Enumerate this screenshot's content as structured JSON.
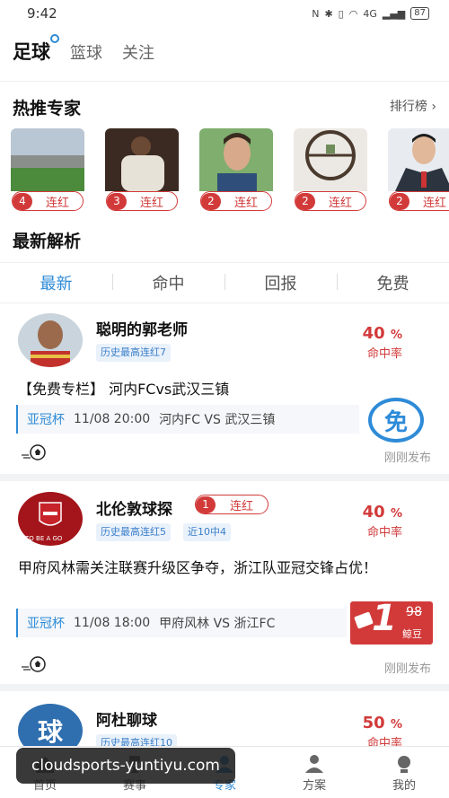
{
  "status_bar": {
    "time": "9:42",
    "battery": "87",
    "network": "4G"
  },
  "sport_tabs": [
    "足球",
    "篮球",
    "关注"
  ],
  "experts_section": {
    "title": "热推专家",
    "rank_link": "排行榜"
  },
  "experts": [
    {
      "streak": "4",
      "label": "连红"
    },
    {
      "streak": "3",
      "label": "连红"
    },
    {
      "streak": "2",
      "label": "连红"
    },
    {
      "streak": "2",
      "label": "连红"
    },
    {
      "streak": "2",
      "label": "连红"
    }
  ],
  "analysis_section": {
    "title": "最新解析"
  },
  "filter_tabs": [
    "最新",
    "命中",
    "回报",
    "免费"
  ],
  "posts": [
    {
      "author": "聪明的郭老师",
      "tags": [
        "历史最高连红7"
      ],
      "hit_rate": "40",
      "hit_rate_unit": "%",
      "hit_rate_label": "命中率",
      "title": "【免费专栏】 河内FCvs武汉三镇",
      "league": "亚冠杯",
      "datetime": "11/08 20:00",
      "match": "河内FC VS 武汉三镇",
      "badge": "免",
      "time": "刚刚发布"
    },
    {
      "author": "北伦敦球探",
      "streak": "1",
      "streak_label": "连红",
      "tags": [
        "历史最高连红5",
        "近10中4"
      ],
      "hit_rate": "40",
      "hit_rate_unit": "%",
      "hit_rate_label": "命中率",
      "title": "甲府风林需关注联赛升级区争夺，浙江队亚冠交锋占优！",
      "league": "亚冠杯",
      "datetime": "11/08 18:00",
      "match": "甲府风林 VS 浙江FC",
      "price": "1",
      "price_old": "98",
      "price_unit": "鲸豆",
      "time": "刚刚发布",
      "avatar_text": "TO BE A GO"
    },
    {
      "author": "阿杜聊球",
      "avatar_char": "球",
      "tags": [
        "历史最高连红10"
      ],
      "hit_rate": "50",
      "hit_rate_unit": "%",
      "hit_rate_label": "命中率"
    }
  ],
  "bottom_nav": [
    "首页",
    "赛事",
    "专家",
    "方案",
    "我的"
  ],
  "watermark": "cloudsports-yuntiyu.com",
  "colors": {
    "accent": "#2e8bd8",
    "red": "#d23a3a"
  }
}
